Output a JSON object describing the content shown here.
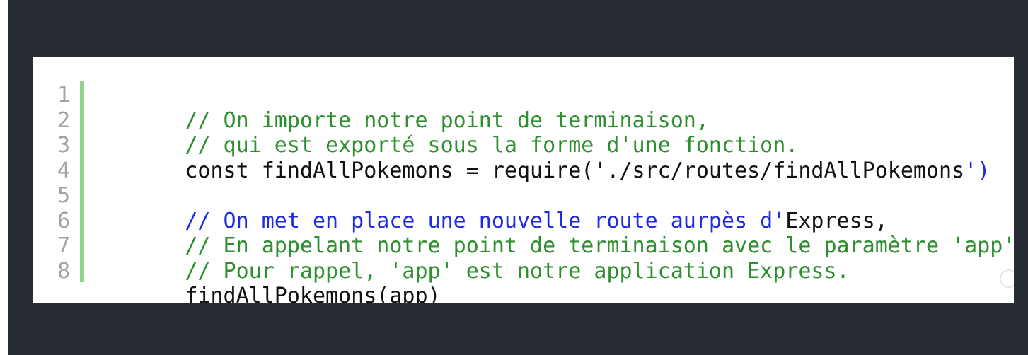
{
  "code_block": {
    "lines": [
      {
        "number": "1",
        "segments": [
          {
            "text": "// On importe notre point de terminaison,",
            "color": "#2d8f2d"
          }
        ]
      },
      {
        "number": "2",
        "segments": [
          {
            "text": "// qui est exporté sous la forme d'une fonction.",
            "color": "#2d8f2d"
          }
        ]
      },
      {
        "number": "3",
        "segments": [
          {
            "text": "const findAllPokemons = require('./src/routes/findAllPokemons",
            "color": "#111111"
          },
          {
            "text": "')",
            "color": "#1f2be0"
          }
        ]
      },
      {
        "number": "4",
        "segments": [
          {
            "text": "",
            "color": "#111111"
          }
        ]
      },
      {
        "number": "5",
        "segments": [
          {
            "text": "// On met en place une nouvelle route aurpès d'",
            "color": "#1f2be0"
          },
          {
            "text": "Express,",
            "color": "#111111"
          }
        ]
      },
      {
        "number": "6",
        "segments": [
          {
            "text": "// En appelant notre point de terminaison avec le paramètre 'app'",
            "color": "#2d8f2d"
          }
        ]
      },
      {
        "number": "7",
        "segments": [
          {
            "text": "// Pour rappel, 'app' est notre application Express.",
            "color": "#2d8f2d"
          }
        ]
      },
      {
        "number": "8",
        "segments": [
          {
            "text": "findAllPokemons(app)",
            "color": "#111111"
          }
        ]
      }
    ]
  },
  "colors": {
    "frame_background": "#282c34",
    "card_background": "#ffffff",
    "gutter_rule": "#8fd28a",
    "comment_green": "#2d8f2d",
    "string_blue": "#1f2be0",
    "line_number": "#a3a3a3"
  }
}
